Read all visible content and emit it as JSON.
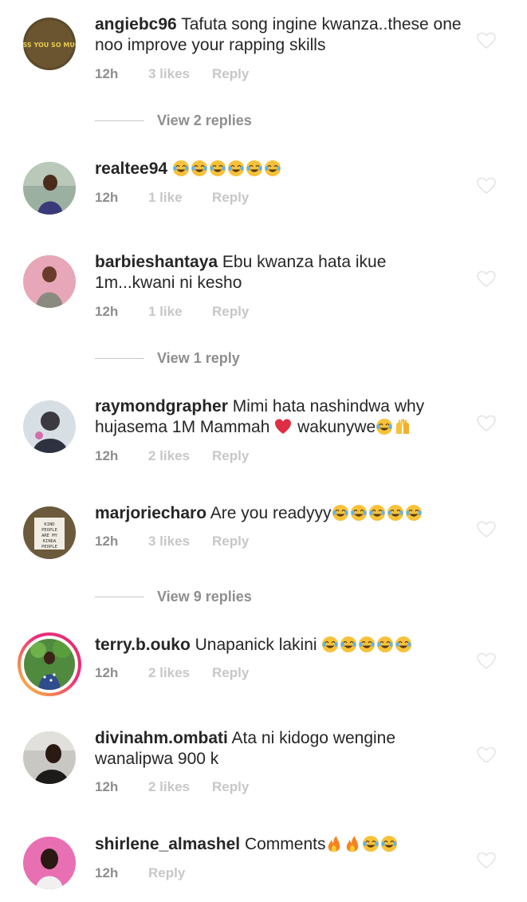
{
  "comments": [
    {
      "username": "angiebc96",
      "text": "Tafuta song ingine kwanza..these one noo improve your rapping skills",
      "emojis": [],
      "time": "12h",
      "likes": "3 likes",
      "reply": "Reply",
      "avatar_text": "MISS YOU SO MUCH"
    },
    {
      "username": "realtee94",
      "text": "",
      "emojis": [
        "tears-of-joy",
        "tears-of-joy",
        "tears-of-joy",
        "tears-of-joy",
        "tears-of-joy",
        "tears-of-joy"
      ],
      "time": "12h",
      "likes": "1 like",
      "reply": "Reply"
    },
    {
      "username": "barbieshantaya",
      "text": "Ebu kwanza hata ikue 1m...kwani ni kesho",
      "emojis": [],
      "time": "12h",
      "likes": "1 like",
      "reply": "Reply"
    },
    {
      "username": "raymondgrapher",
      "text": "Mimi hata nashindwa why hujasema 1M Mammah",
      "text_after": "wakunywe",
      "emojis_mid": [
        "red-heart"
      ],
      "emojis": [
        "tears-of-joy",
        "raising-hands"
      ],
      "time": "12h",
      "likes": "2 likes",
      "reply": "Reply"
    },
    {
      "username": "marjoriecharo",
      "text": "Are you readyyy",
      "emojis": [
        "tears-of-joy",
        "tears-of-joy",
        "tears-of-joy",
        "tears-of-joy",
        "tears-of-joy"
      ],
      "time": "12h",
      "likes": "3 likes",
      "reply": "Reply",
      "avatar_text": "KIND PEOPLE ARE MY KINDA PEOPLE"
    },
    {
      "username": "terry.b.ouko",
      "text": "Unapanick lakini",
      "emojis": [
        "tears-of-joy",
        "tears-of-joy",
        "tears-of-joy",
        "tears-of-joy",
        "tears-of-joy"
      ],
      "time": "12h",
      "likes": "2 likes",
      "reply": "Reply"
    },
    {
      "username": "divinahm.ombati",
      "text": "Ata ni kidogo wengine wanalipwa 900 k",
      "emojis": [],
      "time": "12h",
      "likes": "2 likes",
      "reply": "Reply"
    },
    {
      "username": "shirlene_almashel",
      "text": "Comments",
      "emojis": [
        "fire",
        "fire",
        "tears-of-joy",
        "tears-of-joy"
      ],
      "time": "12h",
      "likes": "",
      "reply": "Reply"
    }
  ],
  "view_replies": [
    {
      "label": "View 2 replies"
    },
    {
      "label": "View 1 reply"
    },
    {
      "label": "View 9 replies"
    }
  ],
  "colors": {
    "text": "#262626",
    "secondary": "#8e8e8e",
    "muted": "#c7c7c7",
    "heart_red": "#e0245e",
    "emoji_yellow": "#f7c23a"
  },
  "icons": {
    "like": "heart-outline-icon"
  }
}
